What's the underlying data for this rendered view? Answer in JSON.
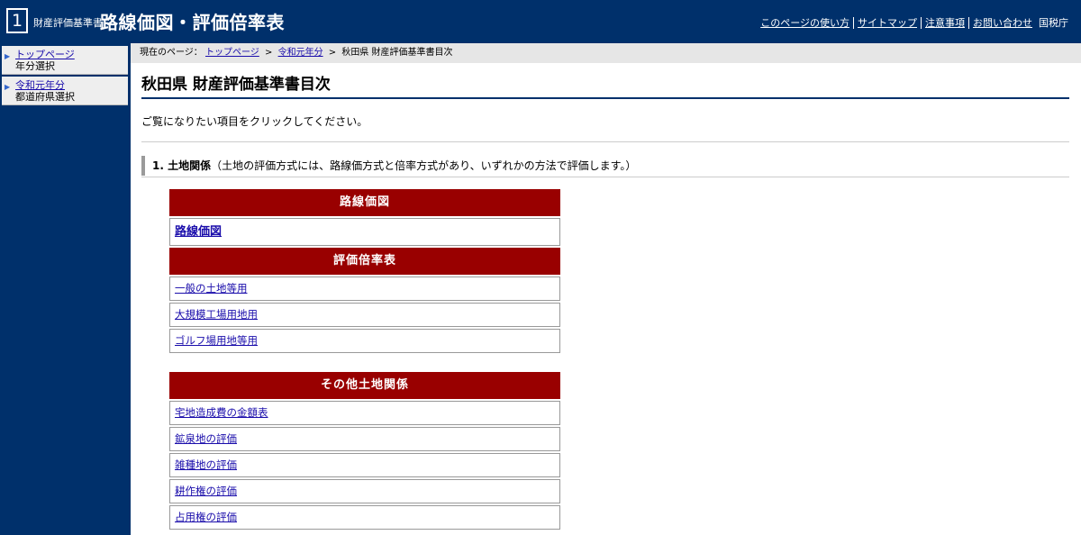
{
  "header": {
    "logo_number": "1",
    "logo_small": "財産評価基準書",
    "logo_main": "路線価図・評価倍率表",
    "nav": [
      "このページの使い方",
      "サイトマップ",
      "注意事項",
      "お問い合わせ"
    ],
    "org": "国税庁"
  },
  "sidebar": {
    "items": [
      {
        "link": "トップページ",
        "sub": "年分選択"
      },
      {
        "link": "令和元年分",
        "sub": "都道府県選択"
      }
    ]
  },
  "breadcrumb": {
    "prefix": "現在のページ：",
    "links": [
      "トップページ",
      "令和元年分"
    ],
    "current": "秋田県 財産評価基準書目次",
    "separator": ">"
  },
  "main": {
    "title": "秋田県  財産評価基準書目次",
    "intro": "ご覧になりたい項目をクリックしてください。",
    "section1": {
      "number_title": "1. 土地関係",
      "note": "（土地の評価方式には、路線価方式と倍率方式があり、いずれかの方法で評価します。）"
    },
    "tables": [
      {
        "header": "路線価図",
        "rows": [
          "路線価図"
        ]
      },
      {
        "header": "評価倍率表",
        "rows": [
          "一般の土地等用",
          "大規模工場用地用",
          "ゴルフ場用地等用"
        ]
      },
      {
        "header": "その他土地関係",
        "rows": [
          "宅地造成費の金額表",
          "鉱泉地の評価",
          "雑種地の評価",
          "耕作権の評価",
          "占用権の評価"
        ]
      }
    ]
  },
  "colors": {
    "header_bg": "#00306b",
    "table_header_bg": "#990000",
    "link": "#1a0dab"
  }
}
